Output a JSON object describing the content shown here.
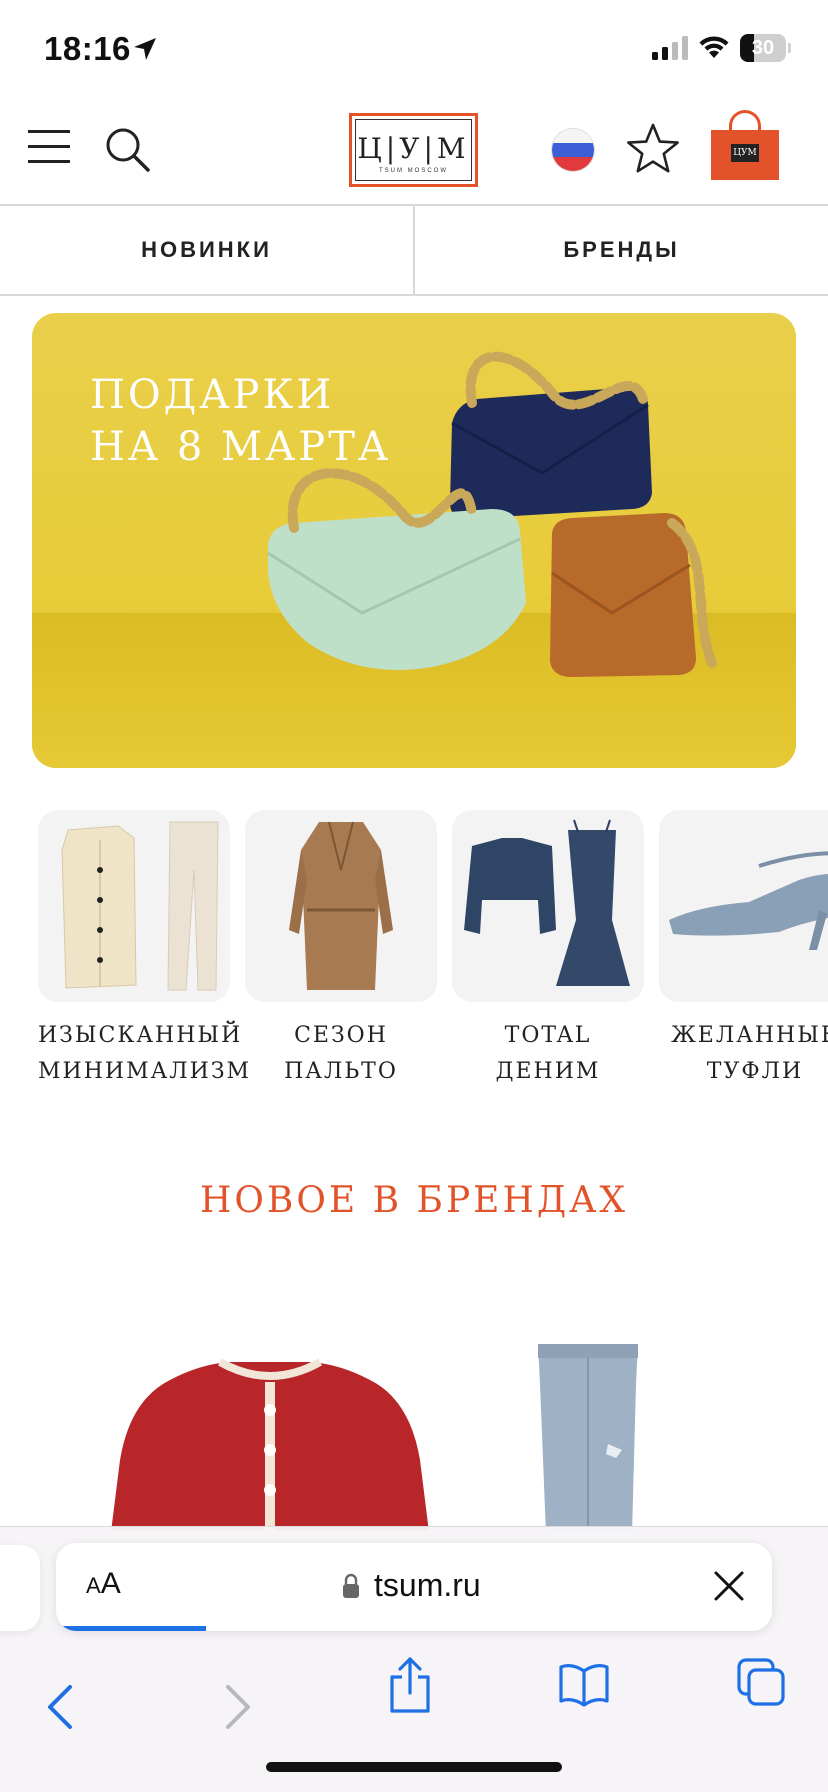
{
  "status_bar": {
    "time": "18:16",
    "battery": "30",
    "battery_level": 0.3,
    "icons": [
      "location-arrow-icon",
      "signal-icon",
      "wifi-icon",
      "battery-icon"
    ]
  },
  "header": {
    "logo_text": "Ц|У|М",
    "logo_subtext": "TSUM MOSCOW",
    "bag_logo_text": "ЦУМ",
    "icons": [
      "menu-icon",
      "search-icon",
      "russia-flag-icon",
      "star-icon",
      "shopping-bag-icon"
    ],
    "brand_color": "#e2532a"
  },
  "tabs": [
    {
      "label": "НОВИНКИ"
    },
    {
      "label": "БРЕНДЫ"
    }
  ],
  "banner": {
    "line1": "ПОДАРКИ",
    "line2": "НА 8 МАРТА",
    "background_color": "#e8cc3a"
  },
  "categories": [
    {
      "label": "ИЗЫСКАННЫЙ\nМИНИМАЛИЗМ"
    },
    {
      "label": "СЕЗОН ПАЛЬТО"
    },
    {
      "label": "TOTAL ДЕНИМ"
    },
    {
      "label": "ЖЕЛАННЫЕ\nТУФЛИ"
    }
  ],
  "section": {
    "title": "НОВОЕ В БРЕНДАХ",
    "title_color": "#e2532a"
  },
  "browser": {
    "aa_small": "A",
    "aa_large": "A",
    "url": "tsum.ru",
    "load_progress": 0.21,
    "progress_color": "#1f6fe5",
    "toolbar_icons": [
      "back-icon",
      "forward-icon",
      "share-icon",
      "bookmarks-icon",
      "tabs-icon"
    ]
  }
}
